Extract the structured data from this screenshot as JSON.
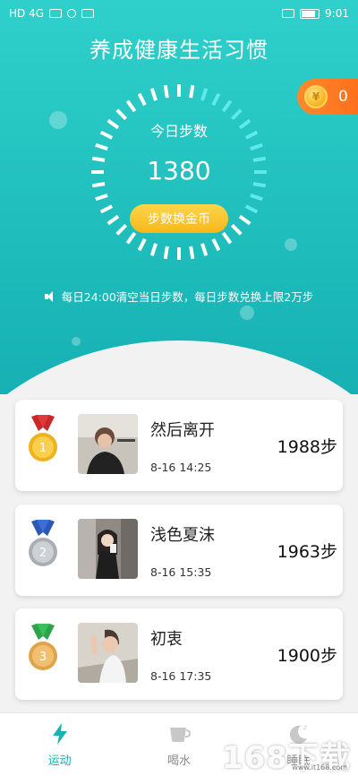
{
  "status_bar": {
    "left_text": "HD 4G",
    "time": "9:01"
  },
  "app": {
    "title": "养成健康生活习惯"
  },
  "coins": {
    "icon": "coin-icon",
    "symbol": "¥",
    "count": "0"
  },
  "steps_panel": {
    "label": "今日步数",
    "value": "1380",
    "exchange_button": "步数换金币",
    "notice": "每日24:00清空当日步数，每日步数兑换上限2万步"
  },
  "ranking": [
    {
      "rank": "1",
      "medal_color": "#f0b21b",
      "ribbon_color": "#e03a3a",
      "name": "然后离开",
      "time": "8-16 14:25",
      "steps": "1988步"
    },
    {
      "rank": "2",
      "medal_color": "#a9aeb3",
      "ribbon_color": "#3a6fd8",
      "name": "浅色夏沫",
      "time": "8-16 15:35",
      "steps": "1963步"
    },
    {
      "rank": "3",
      "medal_color": "#e2a44a",
      "ribbon_color": "#3cbf5a",
      "name": "初衷",
      "time": "8-16 17:35",
      "steps": "1900步"
    }
  ],
  "tabs": [
    {
      "label": "运动",
      "icon": "lightning-icon",
      "active": true
    },
    {
      "label": "喝水",
      "icon": "cup-icon",
      "active": false
    },
    {
      "label": "睡眠",
      "icon": "moon-icon",
      "active": false
    }
  ],
  "colors": {
    "accent": "#20bfbd",
    "button": "#f6b81b",
    "coin_pill": "#ff7424"
  },
  "watermark": {
    "logo": "168下载",
    "sub": "www.it168.com"
  }
}
